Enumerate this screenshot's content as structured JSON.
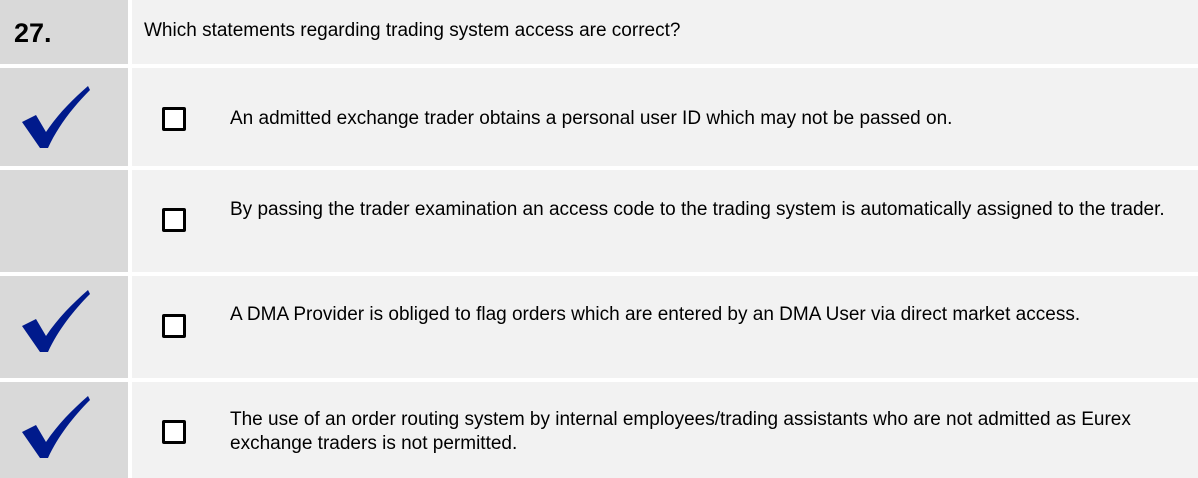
{
  "question": {
    "number": "27.",
    "text": "Which statements regarding trading system access are correct?"
  },
  "answers": [
    {
      "text": "An admitted exchange trader obtains a personal user ID which may not be passed on.",
      "checked": true
    },
    {
      "text": "By passing the trader examination an access code to the trading system is automatically assigned to the trader.",
      "checked": false
    },
    {
      "text": "A DMA Provider is obliged to flag orders which are entered by an DMA User via direct market access.",
      "checked": true
    },
    {
      "text": "The use of an order routing system by internal employees/trading assistants who are not admitted as Eurex exchange traders is not permitted.",
      "checked": true
    }
  ],
  "colors": {
    "tick": "#001a8c",
    "left_bg": "#d9d9d9",
    "right_bg": "#f2f2f2"
  }
}
